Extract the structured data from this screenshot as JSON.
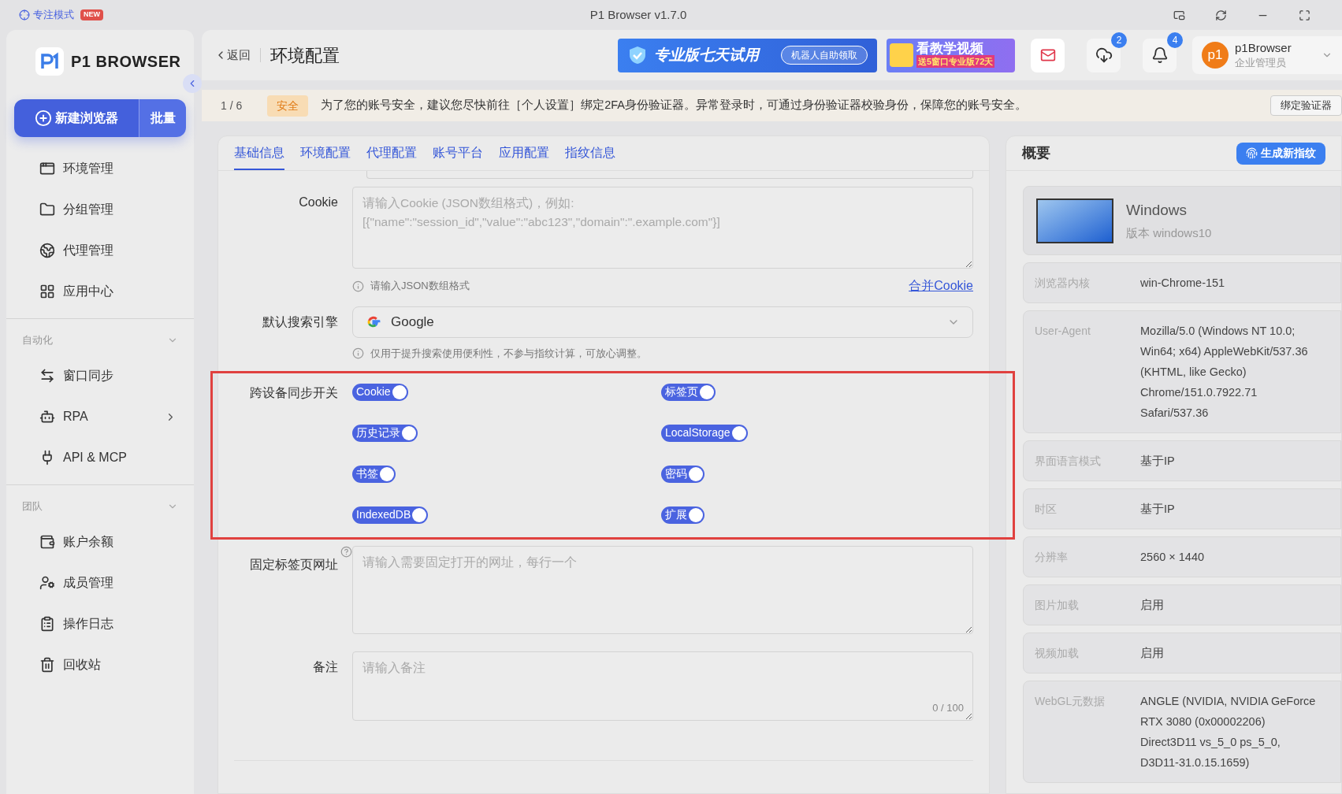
{
  "title_bar": {
    "focus_mode": "专注模式",
    "new_badge": "NEW",
    "title": "P1 Browser v1.7.0"
  },
  "sidebar": {
    "logo": "P1 BROWSER",
    "new_button": "新建浏览器",
    "batch_button": "批量",
    "sections": [
      {
        "items": [
          {
            "label": "环境管理",
            "has_submenu": false
          },
          {
            "label": "分组管理",
            "has_submenu": false
          },
          {
            "label": "代理管理",
            "has_submenu": false
          },
          {
            "label": "应用中心",
            "has_submenu": false
          }
        ]
      },
      {
        "title": "自动化",
        "expanded": true,
        "items": [
          {
            "label": "窗口同步",
            "has_submenu": false
          },
          {
            "label": "RPA",
            "has_submenu": true
          },
          {
            "label": "API & MCP",
            "has_submenu": false
          }
        ]
      },
      {
        "title": "团队",
        "expanded": true,
        "items": [
          {
            "label": "账户余额",
            "has_submenu": false
          },
          {
            "label": "成员管理",
            "has_submenu": false
          },
          {
            "label": "操作日志",
            "has_submenu": false
          },
          {
            "label": "回收站",
            "has_submenu": false
          }
        ]
      }
    ]
  },
  "header": {
    "back": "返回",
    "title": "环境配置",
    "trial_banner": "专业版七天试用",
    "trial_button": "机器人自助领取",
    "video_banner": "看教学视频",
    "video_banner_sub": "送5窗口专业版72天",
    "download_badge": "2",
    "notification_badge": "4",
    "avatar": "p1",
    "user_name": "p1Browser",
    "user_role": "企业管理员"
  },
  "notice": {
    "counter": "1 / 6",
    "tag": "安全",
    "text": "为了您的账号安全，建议您尽快前往［个人设置］绑定2FA身份验证器。异常登录时，可通过身份验证器校验身份，保障您的账号安全。",
    "button": "绑定验证器"
  },
  "tabs": [
    {
      "label": "基础信息",
      "selected": true
    },
    {
      "label": "环境配置",
      "selected": false
    },
    {
      "label": "代理配置",
      "selected": false
    },
    {
      "label": "账号平台",
      "selected": false
    },
    {
      "label": "应用配置",
      "selected": false
    },
    {
      "label": "指纹信息",
      "selected": false
    }
  ],
  "form": {
    "cookie_label": "Cookie",
    "cookie_placeholder": "请输入Cookie (JSON数组格式)，例如:\n[{\"name\":\"session_id\",\"value\":\"abc123\",\"domain\":\".example.com\"}]",
    "cookie_hint": "请输入JSON数组格式",
    "merge_link": "合并Cookie",
    "search_label": "默认搜索引擎",
    "search_value": "Google",
    "search_hint": "仅用于提升搜索使用便利性，不参与指纹计算，可放心调整。",
    "sync_label": "跨设备同步开关",
    "sync_toggles": [
      {
        "label": "Cookie",
        "on": true
      },
      {
        "label": "标签页",
        "on": true
      },
      {
        "label": "历史记录",
        "on": true
      },
      {
        "label": "LocalStorage",
        "on": true
      },
      {
        "label": "书签",
        "on": true
      },
      {
        "label": "密码",
        "on": true
      },
      {
        "label": "IndexedDB",
        "on": true
      },
      {
        "label": "扩展",
        "on": true
      }
    ],
    "pinned_label": "固定标签页网址",
    "pinned_placeholder": "请输入需要固定打开的网址，每行一个",
    "remark_label": "备注",
    "remark_placeholder": "请输入备注",
    "remark_counter": "0 / 100"
  },
  "summary": {
    "title": "概要",
    "generate_button": "生成新指纹",
    "os_name": "Windows",
    "os_version": "版本 windows10",
    "rows": [
      {
        "label": "浏览器内核",
        "value": "win-Chrome-151"
      },
      {
        "label": "User-Agent",
        "value": "Mozilla/5.0 (Windows NT 10.0; Win64; x64) AppleWebKit/537.36 (KHTML, like Gecko) Chrome/151.0.7922.71 Safari/537.36"
      },
      {
        "label": "界面语言模式",
        "value": "基于IP"
      },
      {
        "label": "时区",
        "value": "基于IP"
      },
      {
        "label": "分辨率",
        "value": "2560 × 1440"
      },
      {
        "label": "图片加载",
        "value": "启用"
      },
      {
        "label": "视频加载",
        "value": "启用"
      },
      {
        "label": "WebGL元数据",
        "value": "ANGLE (NVIDIA, NVIDIA GeForce RTX 3080 (0x00002206) Direct3D11 vs_5_0 ps_5_0, D3D11-31.0.15.1659)"
      }
    ]
  }
}
